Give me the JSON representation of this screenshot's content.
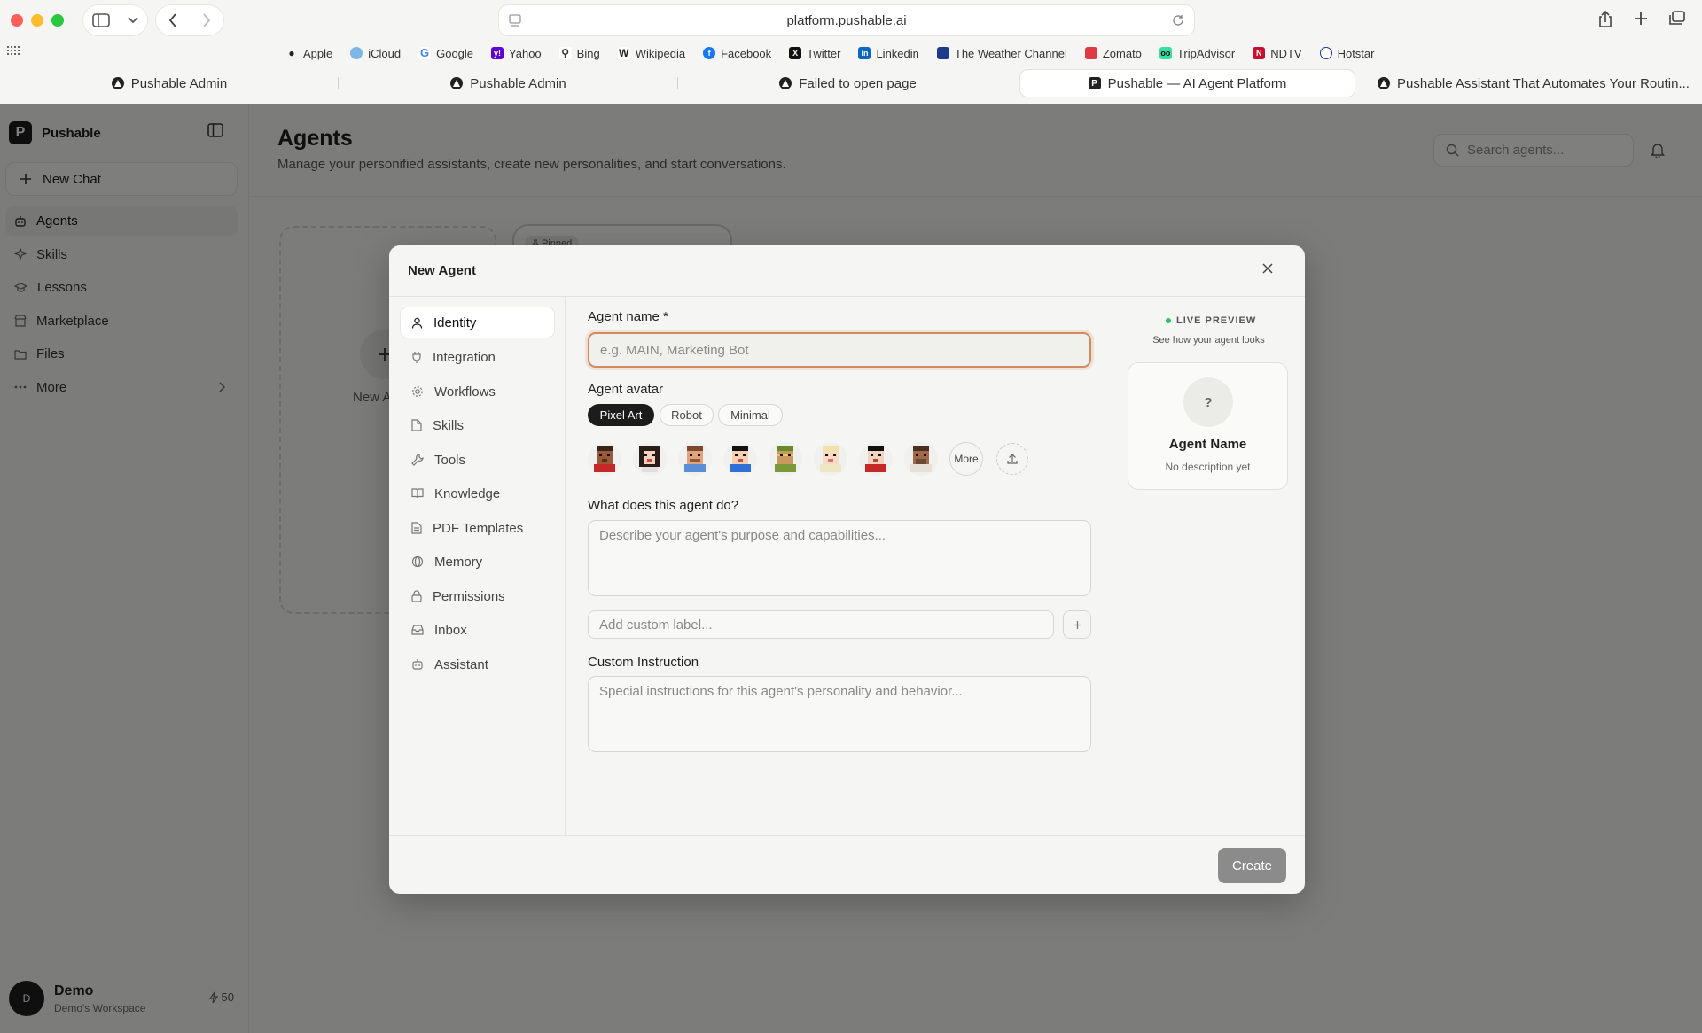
{
  "browser": {
    "url": "platform.pushable.ai",
    "favorites": [
      "Apple",
      "iCloud",
      "Google",
      "Yahoo",
      "Bing",
      "Wikipedia",
      "Facebook",
      "Twitter",
      "Linkedin",
      "The Weather Channel",
      "Zomato",
      "TripAdvisor",
      "NDTV",
      "Hotstar"
    ],
    "tabs": [
      "Pushable Admin",
      "Pushable Admin",
      "Failed to open page",
      "Pushable — AI Agent Platform",
      "Pushable Assistant That Automates Your Routin..."
    ]
  },
  "sidebar": {
    "brand": "Pushable",
    "new_chat": "New Chat",
    "items": [
      "Agents",
      "Skills",
      "Lessons",
      "Marketplace",
      "Files",
      "More"
    ],
    "user": {
      "initial": "D",
      "name": "Demo",
      "workspace": "Demo's Workspace",
      "credits": "50"
    }
  },
  "main": {
    "title": "Agents",
    "subtitle": "Manage your personified assistants, create new personalities, and start conversations.",
    "search_placeholder": "Search agents...",
    "new_agent_card": "New A",
    "pinned_badge": "Pinned"
  },
  "modal": {
    "title": "New Agent",
    "nav": [
      "Identity",
      "Integration",
      "Workflows",
      "Skills",
      "Tools",
      "Knowledge",
      "PDF Templates",
      "Memory",
      "Permissions",
      "Inbox",
      "Assistant"
    ],
    "agent_name_label": "Agent name *",
    "agent_name_placeholder": "e.g. MAIN, Marketing Bot",
    "avatar_label": "Agent avatar",
    "avatar_styles": [
      "Pixel Art",
      "Robot",
      "Minimal"
    ],
    "avatar_more": "More",
    "purpose_label": "What does this agent do?",
    "purpose_placeholder": "Describe your agent's purpose and capabilities...",
    "custom_label_placeholder": "Add custom label...",
    "instruction_label": "Custom Instruction",
    "instruction_placeholder": "Special instructions for this agent's personality and behavior...",
    "create": "Create",
    "preview": {
      "live": "LIVE PREVIEW",
      "sub": "See how your agent looks",
      "avatar": "?",
      "name": "Agent Name",
      "desc": "No description yet"
    }
  }
}
